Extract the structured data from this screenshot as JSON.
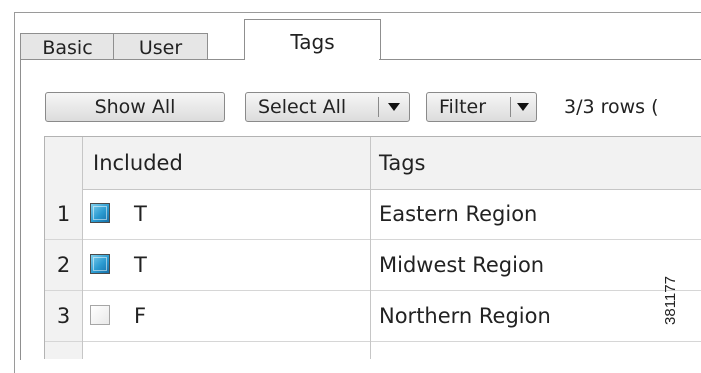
{
  "tabs": [
    {
      "label": "Basic",
      "active": false
    },
    {
      "label": "User",
      "active": false
    },
    {
      "label": "Tags",
      "active": true
    }
  ],
  "toolbar": {
    "show_all_label": "Show All",
    "select_all_label": "Select All",
    "filter_label": "Filter",
    "rows_text": "3/3 rows ("
  },
  "grid": {
    "columns": [
      "Included",
      "Tags"
    ],
    "rows": [
      {
        "num": "1",
        "checked": true,
        "included": "T",
        "tag": "Eastern Region"
      },
      {
        "num": "2",
        "checked": true,
        "included": "T",
        "tag": "Midwest Region"
      },
      {
        "num": "3",
        "checked": false,
        "included": "F",
        "tag": "Northern Region"
      }
    ]
  },
  "figure_id": "381177"
}
